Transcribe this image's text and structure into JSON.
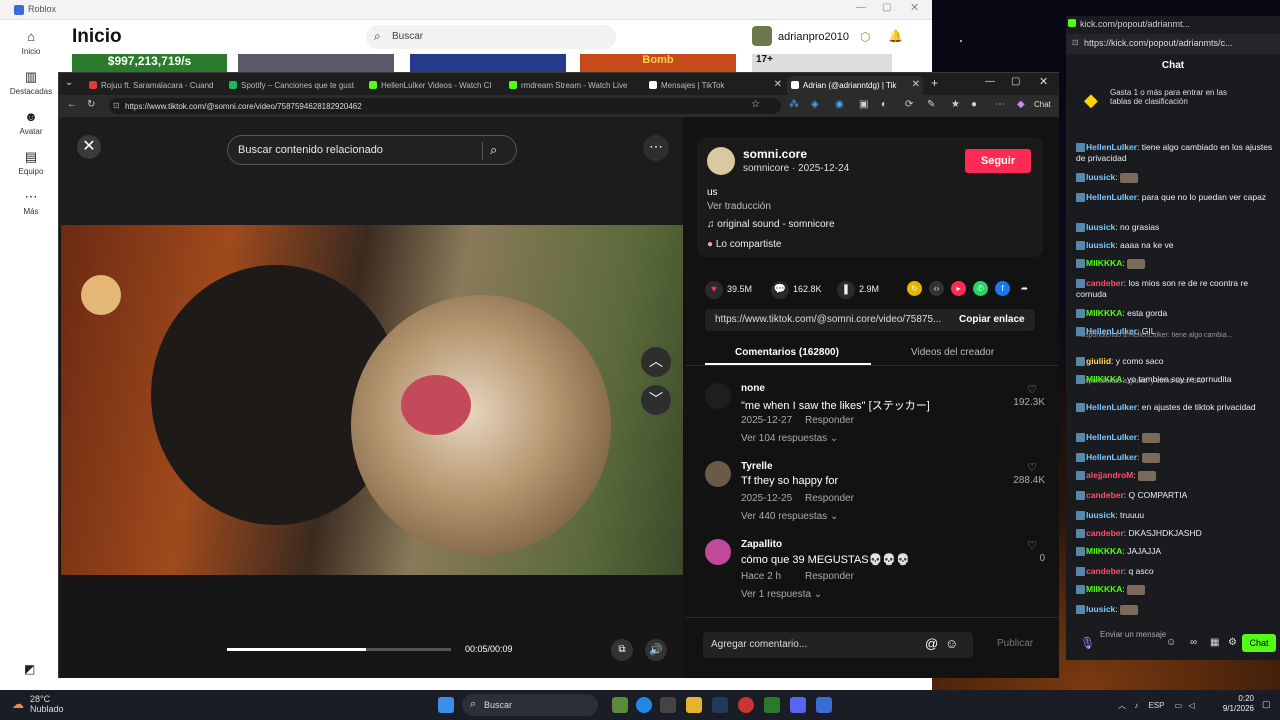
{
  "roblox": {
    "window_title": "Roblox",
    "page_title": "Inicio",
    "search_placeholder": "Buscar",
    "username": "adrianpro2010",
    "nav": [
      {
        "label": "Inicio",
        "icon": "home-icon"
      },
      {
        "label": "Destacadas",
        "icon": "chart-icon"
      },
      {
        "label": "Avatar",
        "icon": "avatar-icon"
      },
      {
        "label": "Equipo",
        "icon": "inventory-icon"
      },
      {
        "label": "Más",
        "icon": "more-icon"
      }
    ],
    "strip": {
      "promo_text": "$997,213,719/s",
      "game_text": "Bomb",
      "age_badge": "17+"
    }
  },
  "browser": {
    "tabs": [
      {
        "label": "Rojuu ft. Saramalacara - Cuand",
        "color": "#e53935"
      },
      {
        "label": "Spotify – Canciones que te gust",
        "color": "#1db954"
      },
      {
        "label": "HellenLulker Videos - Watch Cl",
        "color": "#53fc18"
      },
      {
        "label": "rmdream Stream - Watch Live",
        "color": "#53fc18"
      },
      {
        "label": "Mensajes | TikTok",
        "color": "#ffffff"
      },
      {
        "label": "Adrian (@adrianntdg) | Tik",
        "color": "#ffffff"
      }
    ],
    "url": "https://www.tiktok.com/@somni.core/video/7587594628182920462",
    "chat_label": "Chat"
  },
  "tiktok": {
    "search_placeholder": "Buscar contenido relacionado",
    "time": "00:05/00:09",
    "progress": 0.62,
    "author": {
      "name": "somni.core",
      "meta": "somnicore · 2025-12-24"
    },
    "follow_label": "Seguir",
    "caption": "us",
    "translate": "Ver traducción",
    "sound": "original sound - somnicore",
    "shared": "Lo compartiste",
    "stats": {
      "likes": "39.5M",
      "comments": "162.8K",
      "saves": "2.9M"
    },
    "link": "https://www.tiktok.com/@somni.core/video/75875...",
    "copy_link": "Copiar enlace",
    "tab_comments": "Comentarios (162800)",
    "tab_videos": "Videos del creador",
    "comments": [
      {
        "name": "none",
        "text": "\"me when I saw the likes\" [ステッカー]",
        "date": "2025-12-27",
        "reply": "Responder",
        "replies": "Ver 104 respuestas",
        "likes": "192.3K"
      },
      {
        "name": "Tyrelle",
        "text": "Tf they so happy for",
        "date": "2025-12-25",
        "reply": "Responder",
        "replies": "Ver 440 respuestas",
        "likes": "288.4K"
      },
      {
        "name": "Zapallito",
        "text": "cómo que 39 MEGUSTAS💀💀💀",
        "date": "Hace 2 h",
        "reply": "Responder",
        "replies": "Ver 1 respuesta",
        "likes": "0"
      }
    ],
    "comment_placeholder": "Agregar comentario...",
    "publish": "Publicar"
  },
  "kick": {
    "window_title": "kick.com/popout/adrianmt...",
    "url": "https://kick.com/popout/adrianmts/c...",
    "chat_title": "Chat",
    "gift_text": "Gasta 1 o más para entrar en las tablas de clasificación",
    "messages": [
      {
        "user": "HellenLulker",
        "color": "#7ec8ff",
        "text": "tiene algo cambiado en los ajustes de privacidad"
      },
      {
        "user": "luusick",
        "color": "#7ec8ff",
        "text": ""
      },
      {
        "user": "HellenLulker",
        "color": "#7ec8ff",
        "text": "para que no lo puedan ver capaz"
      },
      {
        "user": "luusick",
        "color": "#7ec8ff",
        "text": "no grasias"
      },
      {
        "user": "luusick",
        "color": "#7ec8ff",
        "text": "aaaa na ke ve"
      },
      {
        "user": "MIIKKKA",
        "color": "#53fc18",
        "text": ""
      },
      {
        "user": "candeber",
        "color": "#ff4d6d",
        "text": "los mios son re de re coontra re cornuda"
      },
      {
        "user": "MIIKKKA",
        "color": "#53fc18",
        "text": "esta gorda"
      },
      {
        "user": "HellenLulker",
        "color": "#7ec8ff",
        "text": "GIL"
      },
      {
        "user": "giuliid",
        "color": "#ffd75a",
        "text": "y como saco"
      },
      {
        "user": "MIIKKKA",
        "color": "#53fc18",
        "text": "yo tambien soy re cornudita"
      },
      {
        "user": "HellenLulker",
        "color": "#7ec8ff",
        "text": "en ajustes de tiktok privacidad"
      },
      {
        "user": "HellenLulker",
        "color": "#7ec8ff",
        "text": ""
      },
      {
        "user": "HellenLulker",
        "color": "#7ec8ff",
        "text": ""
      },
      {
        "user": "alejjandroM",
        "color": "#ff4d6d",
        "text": ""
      },
      {
        "user": "candeber",
        "color": "#ff4d6d",
        "text": "Q COMPARTIA"
      },
      {
        "user": "luusick",
        "color": "#7ec8ff",
        "text": "truuuu"
      },
      {
        "user": "candeber",
        "color": "#ff4d6d",
        "text": "DKASJHDKJASHD"
      },
      {
        "user": "MIIKKKA",
        "color": "#53fc18",
        "text": "JAJAJJA"
      },
      {
        "user": "candeber",
        "color": "#ff4d6d",
        "text": "q asco"
      },
      {
        "user": "MIIKKKA",
        "color": "#53fc18",
        "text": ""
      },
      {
        "user": "luusick",
        "color": "#7ec8ff",
        "text": ""
      }
    ],
    "reply1": "Respondiendo a HellenLulker: tiene algo cambia...",
    "reply2": "Respondiendo a giuliid: y como saco SAJ",
    "send_placeholder": "Enviar un mensaje",
    "chat_button": "Chat"
  },
  "taskbar": {
    "temp": "28°C",
    "weather": "Nublado",
    "search": "Buscar",
    "lang": "ESP",
    "time": "0:20",
    "date": "9/1/2026"
  }
}
